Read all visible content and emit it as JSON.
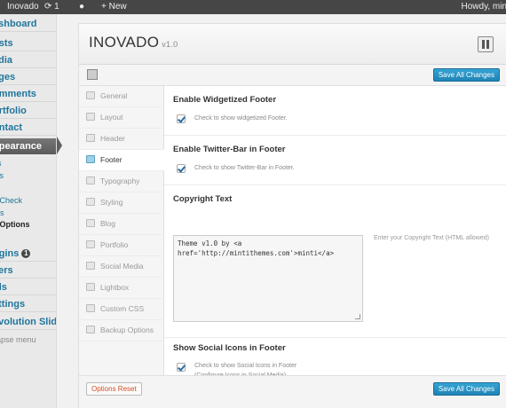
{
  "adminbar": {
    "site": "Inovado",
    "updates": "1",
    "new": "+ New",
    "howdy": "Howdy, min"
  },
  "sidebar": {
    "items": [
      {
        "label": "ashboard"
      },
      {
        "label": "osts"
      },
      {
        "label": "edia"
      },
      {
        "label": "ages"
      },
      {
        "label": "omments"
      },
      {
        "label": "ortfolio"
      },
      {
        "label": "ontact"
      }
    ],
    "active": "ppearance",
    "sub": [
      "es",
      "ets",
      "s",
      "e Check",
      "ars",
      "e Options"
    ],
    "items2": [
      {
        "label": "ugins",
        "badge": "1"
      },
      {
        "label": "sers"
      },
      {
        "label": "ols"
      },
      {
        "label": "ettings"
      },
      {
        "label": "evolution Slider"
      }
    ],
    "collapse": "llapse menu"
  },
  "panel": {
    "title": "INOVADO",
    "version": "v1.0",
    "save_label": "Save All Changes",
    "reset_label": "Options Reset"
  },
  "menu": [
    {
      "label": "General",
      "icon": "gear-icon"
    },
    {
      "label": "Layout",
      "icon": "layout-icon"
    },
    {
      "label": "Header",
      "icon": "header-icon"
    },
    {
      "label": "Footer",
      "icon": "footer-icon"
    },
    {
      "label": "Typography",
      "icon": "typography-icon"
    },
    {
      "label": "Styling",
      "icon": "palette-icon"
    },
    {
      "label": "Blog",
      "icon": "pencil-icon"
    },
    {
      "label": "Portfolio",
      "icon": "portfolio-icon"
    },
    {
      "label": "Social Media",
      "icon": "social-icon"
    },
    {
      "label": "Lightbox",
      "icon": "lightbox-icon"
    },
    {
      "label": "Custom CSS",
      "icon": "css-icon"
    },
    {
      "label": "Backup Options",
      "icon": "backup-icon"
    }
  ],
  "sections": {
    "widget_footer": {
      "title": "Enable Widgetized Footer",
      "desc": "Check to show widgetized Footer."
    },
    "twitter": {
      "title": "Enable Twitter-Bar in Footer",
      "desc": "Check to show Twitter-Bar in Footer."
    },
    "copyright": {
      "title": "Copyright Text",
      "line1": "Theme v1.0 by <a",
      "line2": "href='http://mintithemes.com'>minti</a>",
      "hint": "Enter your Copyright Text (HTML allowed)"
    },
    "social": {
      "title": "Show Social Icons in Footer",
      "desc1": "Check to show Social Icons in Footer",
      "desc2": "(Configure Icons in Social Media)"
    }
  }
}
